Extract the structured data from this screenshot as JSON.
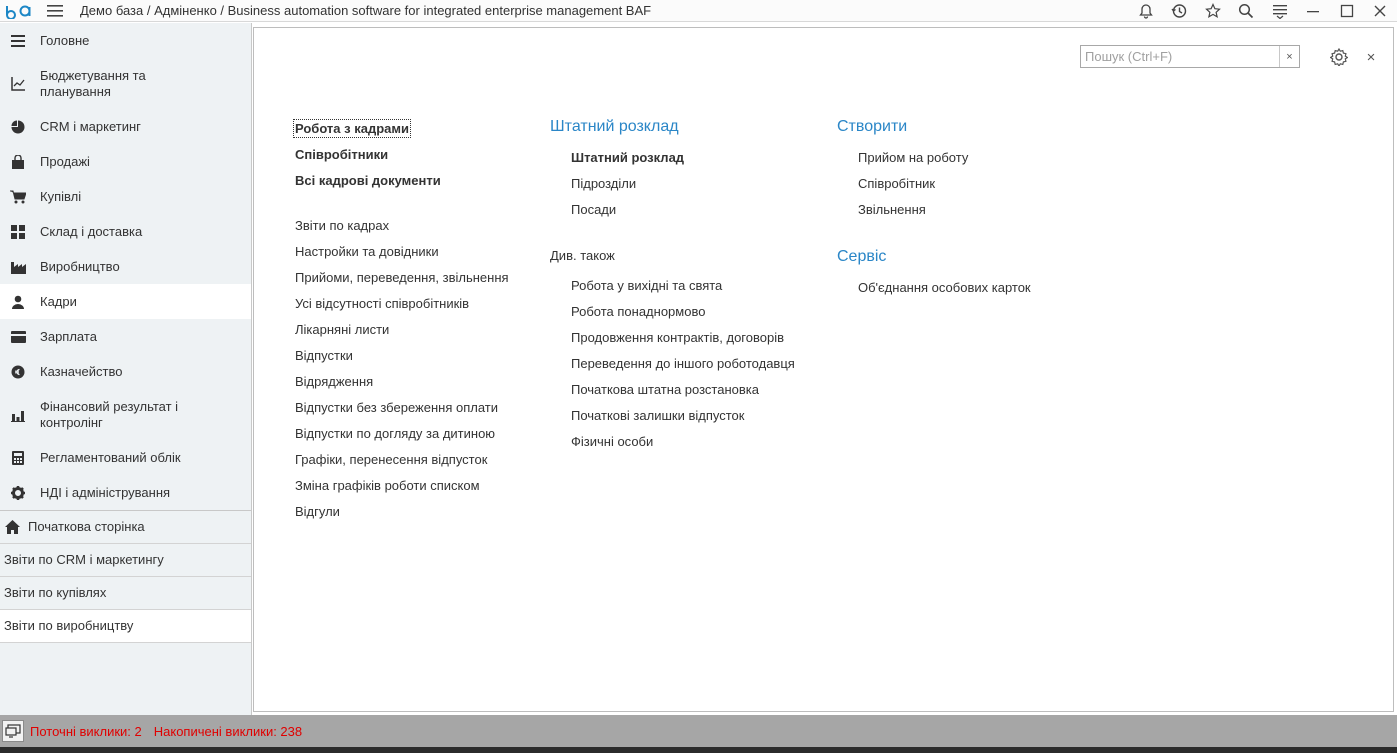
{
  "header": {
    "title": "Демо база / Адміненко / Business automation software for integrated enterprise management BAF",
    "icons": [
      "bell-icon",
      "history-icon",
      "star-icon",
      "search-icon",
      "settings-menu-icon",
      "minimize-icon",
      "maximize-icon",
      "close-icon"
    ]
  },
  "sidebar": {
    "items": [
      {
        "label": "Головне",
        "icon": "menu-lines-icon"
      },
      {
        "label": "Бюджетування та планування",
        "icon": "chart-axis-icon"
      },
      {
        "label": "CRM і маркетинг",
        "icon": "pie-chart-icon"
      },
      {
        "label": "Продажі",
        "icon": "shopping-bag-icon"
      },
      {
        "label": "Купівлі",
        "icon": "cart-icon"
      },
      {
        "label": "Склад і доставка",
        "icon": "grid-icon"
      },
      {
        "label": "Виробництво",
        "icon": "factory-icon"
      },
      {
        "label": "Кадри",
        "icon": "person-icon"
      },
      {
        "label": "Зарплата",
        "icon": "wallet-icon"
      },
      {
        "label": "Казначейство",
        "icon": "currency-icon"
      },
      {
        "label": "Фінансовий результат і контролінг",
        "icon": "bar-chart-icon"
      },
      {
        "label": "Регламентований облік",
        "icon": "calculator-icon"
      },
      {
        "label": "НДІ і адміністрування",
        "icon": "gear-icon"
      }
    ],
    "open_windows": [
      {
        "label": "Початкова сторінка",
        "icon": "home-icon"
      },
      {
        "label": "Звіти по CRM і маркетингу"
      },
      {
        "label": "Звіти по купівлях"
      },
      {
        "label": "Звіти по виробництву"
      }
    ]
  },
  "search": {
    "placeholder": "Пошук (Ctrl+F)",
    "clear": "×"
  },
  "panel": {
    "close": "×",
    "col1": {
      "main_links": [
        "Робота з кадрами",
        "Співробітники",
        "Всі кадрові документи"
      ],
      "links": [
        "Звіти по кадрах",
        "Настройки та довідники",
        "Прийоми, переведення, звільнення",
        "Усі відсутності співробітників",
        "Лікарняні листи",
        "Відпустки",
        "Відрядження",
        "Відпустки без збереження оплати",
        "Відпустки по догляду за дитиною",
        "Графіки, перенесення відпусток",
        "Зміна графіків роботи списком",
        "Відгули"
      ]
    },
    "col2": {
      "title": "Штатний розклад",
      "links": [
        "Штатний розклад",
        "Підрозділи",
        "Посади"
      ],
      "see_also": "Див. також",
      "see_also_links": [
        "Робота у вихідні та свята",
        "Робота понаднормово",
        "Продовження контрактів, договорів",
        "Переведення до іншого роботодавця",
        "Початкова штатна розстановка",
        "Початкові залишки відпусток",
        "Фізичні особи"
      ]
    },
    "col3": {
      "create_title": "Створити",
      "create_links": [
        "Прийом на роботу",
        "Співробітник",
        "Звільнення"
      ],
      "service_title": "Сервіс",
      "service_links": [
        "Об'єднання особових карток"
      ]
    }
  },
  "status": {
    "current_calls": "Поточні виклики: 2",
    "total_calls": "Накопичені виклики: 238"
  },
  "colors": {
    "accent": "#2a86c7",
    "sidebar_bg": "#eef2f4",
    "status_bar": "#a6a6a6",
    "status_text": "#e00000"
  }
}
